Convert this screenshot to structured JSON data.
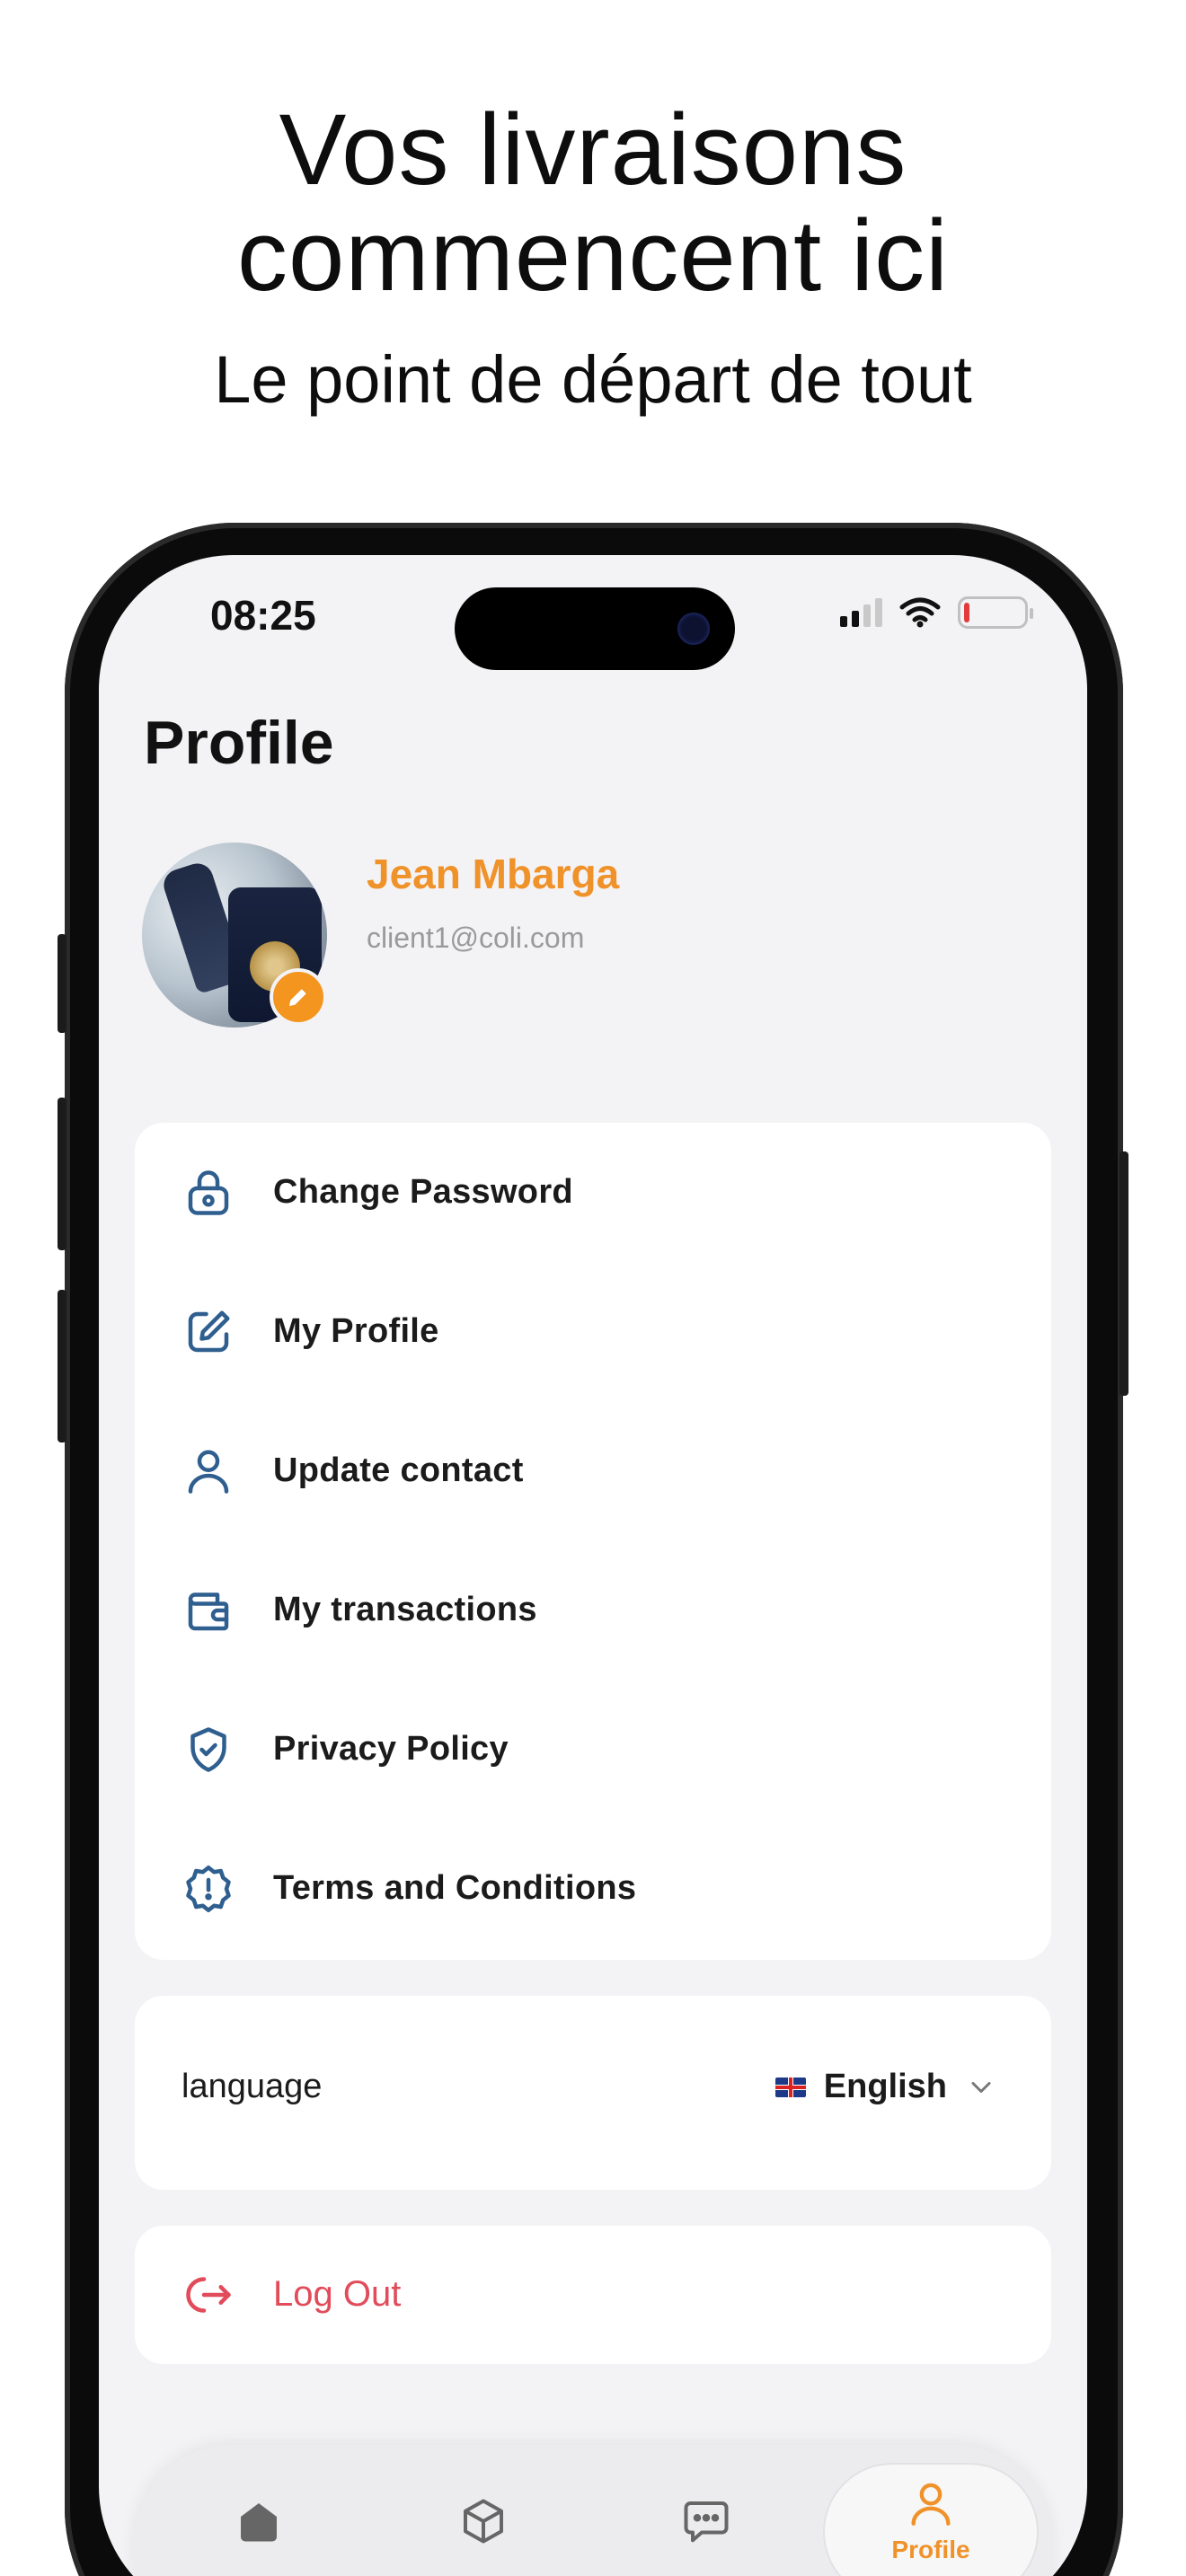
{
  "marketing": {
    "title_line1": "Vos livraisons",
    "title_line2": "commencent ici",
    "subtitle": "Le point de départ de tout"
  },
  "status_bar": {
    "time": "08:25",
    "icons": [
      "cellular-signal-icon",
      "wifi-icon",
      "battery-icon"
    ],
    "battery_level": 0.1
  },
  "profile": {
    "title": "Profile",
    "name": "Jean Mbarga",
    "email": "client1@coli.com",
    "avatar_icon": "avatar-photo",
    "edit_icon": "pencil-icon"
  },
  "menu": {
    "items": [
      {
        "label": "Change Password",
        "icon": "lock-icon"
      },
      {
        "label": "My Profile",
        "icon": "edit-square-icon"
      },
      {
        "label": "Update contact",
        "icon": "user-icon"
      },
      {
        "label": "My transactions",
        "icon": "wallet-icon"
      },
      {
        "label": "Privacy Policy",
        "icon": "shield-check-icon"
      },
      {
        "label": "Terms and Conditions",
        "icon": "alert-badge-icon"
      }
    ]
  },
  "language": {
    "label": "language",
    "value": "English",
    "flag_icon": "uk-flag-icon"
  },
  "logout": {
    "label": "Log Out",
    "icon": "logout-icon"
  },
  "tabbar": {
    "tabs": [
      {
        "icon": "home-icon",
        "label": ""
      },
      {
        "icon": "package-icon",
        "label": ""
      },
      {
        "icon": "chat-icon",
        "label": ""
      },
      {
        "icon": "profile-icon",
        "label": "Profile"
      }
    ],
    "active_index": 3
  },
  "colors": {
    "accent": "#f0922a",
    "icon_blue": "#2f5f8f",
    "danger": "#e14b5a",
    "background": "#f3f3f5"
  }
}
